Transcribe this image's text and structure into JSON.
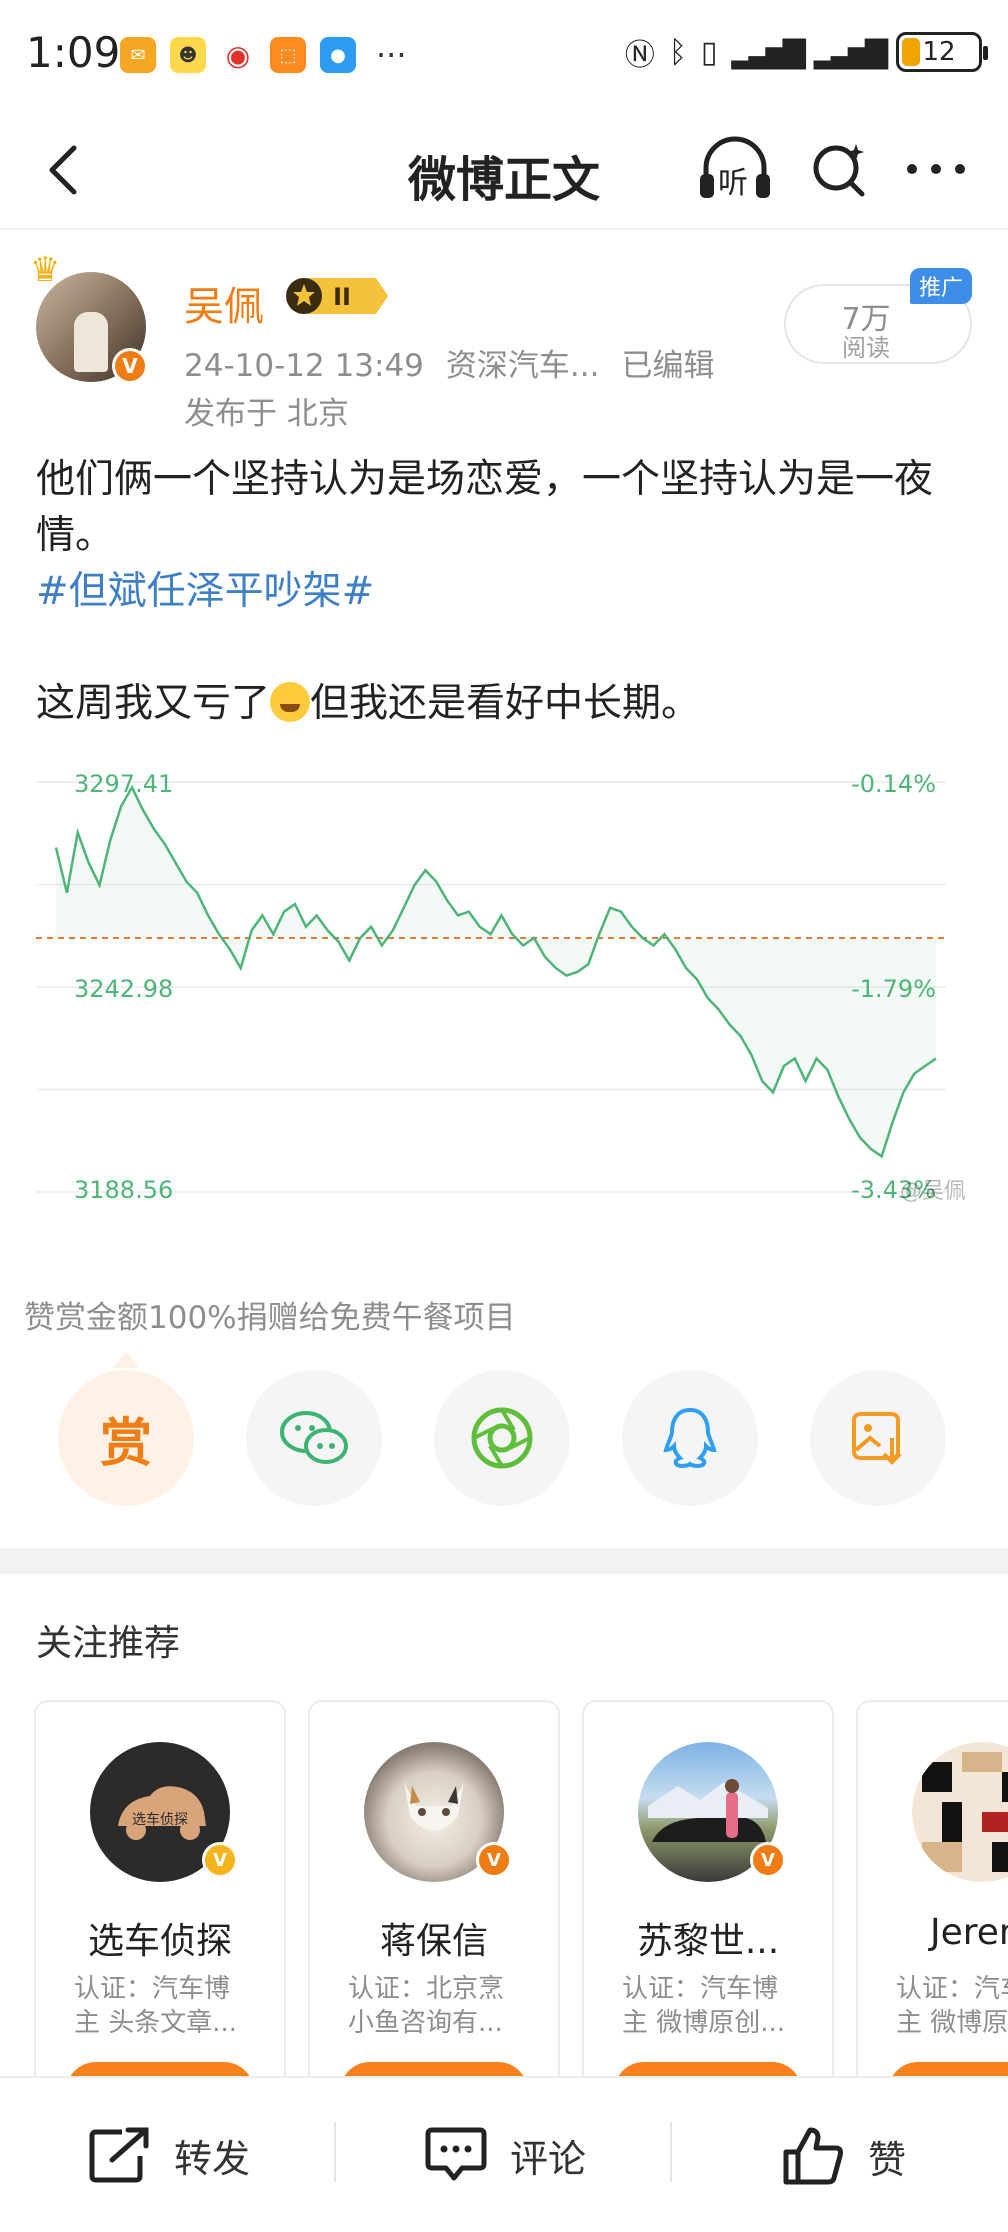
{
  "status_bar": {
    "time": "1:09",
    "battery": "12",
    "more": "···"
  },
  "nav": {
    "title": "微博正文",
    "listen_label": "听"
  },
  "post": {
    "author": "吴佩",
    "level": "II",
    "date": "24-10-12 13:49",
    "source": "资深汽车...",
    "edited": "已编辑",
    "location": "发布于 北京",
    "reads": "7万",
    "reads_label": "阅读",
    "promo": "推广",
    "text_line1": "他们俩一个坚持认为是场恋爱，一个坚持认为是一夜情。",
    "hashtag": "#但斌任泽平吵架#",
    "text_line2a": "这周我又亏了",
    "text_line2b": "但我还是看好中长期。"
  },
  "chart_data": {
    "type": "line",
    "y_labels_left": [
      "3297.41",
      "3242.98",
      "3188.56"
    ],
    "y_labels_right": [
      "-0.14%",
      "-1.79%",
      "-3.43%"
    ],
    "ylim": [
      3188.56,
      3297.41
    ],
    "baseline": 3256.0,
    "watermark": "@吴佩",
    "series": [
      {
        "values": [
          3280,
          3268,
          3284,
          3276,
          3270,
          3282,
          3291,
          3296,
          3290,
          3285,
          3281,
          3276,
          3271,
          3268,
          3262,
          3257,
          3253,
          3248,
          3258,
          3262,
          3257,
          3263,
          3265,
          3259,
          3262,
          3258,
          3255,
          3250,
          3256,
          3259,
          3254,
          3258,
          3264,
          3270,
          3274,
          3271,
          3266,
          3262,
          3263,
          3259,
          3257,
          3262,
          3257,
          3254,
          3256,
          3251,
          3248,
          3246,
          3247,
          3249,
          3257,
          3264,
          3263,
          3259,
          3256,
          3254,
          3257,
          3253,
          3248,
          3245,
          3240,
          3237,
          3233,
          3230,
          3225,
          3218,
          3215,
          3222,
          3224,
          3218,
          3224,
          3221,
          3214,
          3208,
          3203,
          3200,
          3198,
          3207,
          3215,
          3220,
          3222,
          3224
        ]
      }
    ],
    "line_color": "#4fb477",
    "baseline_color": "#e07b39"
  },
  "reward": {
    "note": "赞赏金额100%捐赠给免费午餐项目",
    "reward_char": "赏"
  },
  "recommend": {
    "title": "关注推荐",
    "cards": [
      {
        "name": "选车侦探",
        "desc": "认证：汽车博主 头条文章...",
        "logo_text": "选车侦探"
      },
      {
        "name": "蒋保信",
        "desc": "认证：北京烹小鱼咨询有..."
      },
      {
        "name": "苏黎世...",
        "desc": "认证：汽车博主 微博原创..."
      },
      {
        "name": "Jerem",
        "desc": "认证：汽车博主 微博原"
      }
    ]
  },
  "bottom": {
    "repost": "转发",
    "comment": "评论",
    "like": "赞"
  }
}
